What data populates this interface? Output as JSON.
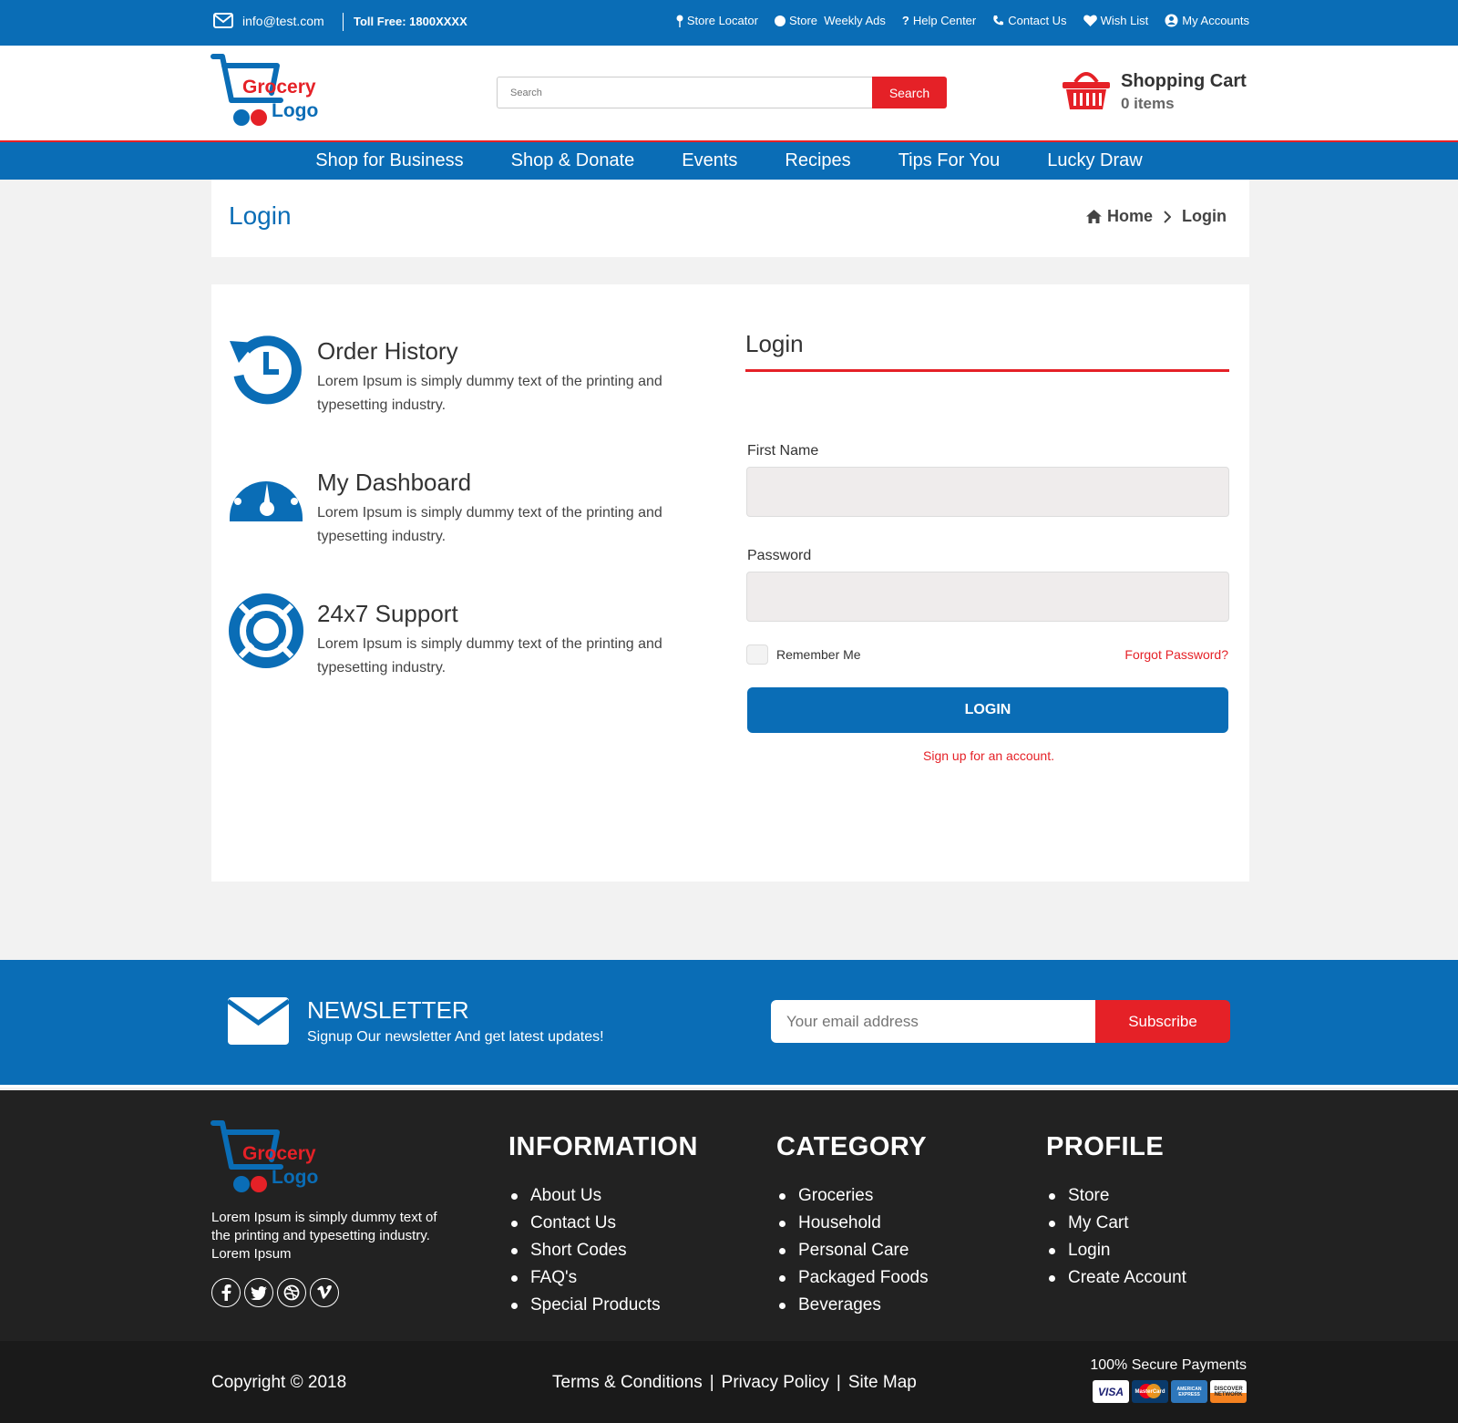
{
  "colors": {
    "primary": "#0a6db6",
    "accent": "#e52127",
    "footer_bg": "#222222"
  },
  "topbar": {
    "email": "info@test.com",
    "toll_free": "Toll Free: 1800XXXX",
    "links": {
      "store_locator": "Store Locator",
      "weekly_ads": "Store  Weekly Ads",
      "help_center": "Help Center",
      "contact_us": "Contact Us",
      "wish_list": "Wish List",
      "my_accounts": "My Accounts"
    }
  },
  "header": {
    "logo": {
      "line1": "Grocery",
      "line2": "Logo"
    },
    "search": {
      "placeholder": "Search",
      "button": "Search"
    },
    "cart": {
      "title": "Shopping Cart",
      "count": "0 items",
      "icon": "basket-icon"
    }
  },
  "nav": {
    "items": [
      "Shop for Business",
      "Shop & Donate",
      "Events",
      "Recipes",
      "Tips For You",
      "Lucky Draw"
    ]
  },
  "page": {
    "title": "Login",
    "breadcrumb": {
      "home": "Home",
      "current": "Login"
    }
  },
  "features": [
    {
      "title": "Order History",
      "text": "Lorem Ipsum is simply dummy text of the printing and typesetting industry.",
      "icon": "history-icon"
    },
    {
      "title": "My Dashboard",
      "text": "Lorem Ipsum is simply dummy text of the printing and typesetting industry.",
      "icon": "dashboard-icon"
    },
    {
      "title": "24x7 Support",
      "text": "Lorem Ipsum is simply dummy text of the printing and typesetting industry.",
      "icon": "lifebuoy-icon"
    }
  ],
  "login": {
    "heading": "Login",
    "first_name_label": "First Name",
    "first_name_value": "",
    "password_label": "Password",
    "password_value": "",
    "remember_me": "Remember Me",
    "remember_checked": false,
    "forgot": "Forgot Password?",
    "button": "LOGIN",
    "signup": "Sign up for an account."
  },
  "newsletter": {
    "title": "NEWSLETTER",
    "subtitle": "Signup Our newsletter And get latest updates!",
    "placeholder": "Your email address",
    "button": "Subscribe"
  },
  "footer": {
    "logo": {
      "line1": "Grocery",
      "line2": "Logo"
    },
    "about": "Lorem Ipsum is simply dummy text of the printing and typesetting industry. Lorem Ipsum",
    "social": [
      "facebook-icon",
      "twitter-icon",
      "dribbble-icon",
      "vimeo-icon"
    ],
    "information": {
      "title": "INFORMATION",
      "items": [
        "About Us",
        "Contact Us",
        "Short Codes",
        "FAQ's",
        "Special Products"
      ]
    },
    "category": {
      "title": "CATEGORY",
      "items": [
        "Groceries",
        "Household",
        "Personal Care",
        "Packaged Foods",
        "Beverages"
      ]
    },
    "profile": {
      "title": "PROFILE",
      "items": [
        "Store",
        "My Cart",
        "Login",
        "Create Account"
      ]
    },
    "copyright": "Copyright © 2018",
    "legal": {
      "terms": "Terms & Conditions",
      "sep": "|",
      "privacy": "Privacy Policy",
      "sitemap": "Site Map"
    },
    "secure": "100% Secure Payments",
    "cards": [
      "VISA",
      "MasterCard",
      "AMERICAN EXPRESS",
      "DISCOVER NETWORK"
    ]
  }
}
